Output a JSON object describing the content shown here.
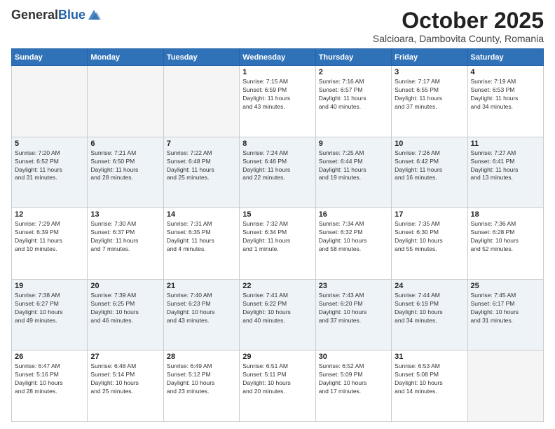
{
  "header": {
    "logo_general": "General",
    "logo_blue": "Blue",
    "month_title": "October 2025",
    "subtitle": "Salcioara, Dambovita County, Romania"
  },
  "days_of_week": [
    "Sunday",
    "Monday",
    "Tuesday",
    "Wednesday",
    "Thursday",
    "Friday",
    "Saturday"
  ],
  "weeks": [
    [
      {
        "day": "",
        "info": ""
      },
      {
        "day": "",
        "info": ""
      },
      {
        "day": "",
        "info": ""
      },
      {
        "day": "1",
        "info": "Sunrise: 7:15 AM\nSunset: 6:59 PM\nDaylight: 11 hours\nand 43 minutes."
      },
      {
        "day": "2",
        "info": "Sunrise: 7:16 AM\nSunset: 6:57 PM\nDaylight: 11 hours\nand 40 minutes."
      },
      {
        "day": "3",
        "info": "Sunrise: 7:17 AM\nSunset: 6:55 PM\nDaylight: 11 hours\nand 37 minutes."
      },
      {
        "day": "4",
        "info": "Sunrise: 7:19 AM\nSunset: 6:53 PM\nDaylight: 11 hours\nand 34 minutes."
      }
    ],
    [
      {
        "day": "5",
        "info": "Sunrise: 7:20 AM\nSunset: 6:52 PM\nDaylight: 11 hours\nand 31 minutes."
      },
      {
        "day": "6",
        "info": "Sunrise: 7:21 AM\nSunset: 6:50 PM\nDaylight: 11 hours\nand 28 minutes."
      },
      {
        "day": "7",
        "info": "Sunrise: 7:22 AM\nSunset: 6:48 PM\nDaylight: 11 hours\nand 25 minutes."
      },
      {
        "day": "8",
        "info": "Sunrise: 7:24 AM\nSunset: 6:46 PM\nDaylight: 11 hours\nand 22 minutes."
      },
      {
        "day": "9",
        "info": "Sunrise: 7:25 AM\nSunset: 6:44 PM\nDaylight: 11 hours\nand 19 minutes."
      },
      {
        "day": "10",
        "info": "Sunrise: 7:26 AM\nSunset: 6:42 PM\nDaylight: 11 hours\nand 16 minutes."
      },
      {
        "day": "11",
        "info": "Sunrise: 7:27 AM\nSunset: 6:41 PM\nDaylight: 11 hours\nand 13 minutes."
      }
    ],
    [
      {
        "day": "12",
        "info": "Sunrise: 7:29 AM\nSunset: 6:39 PM\nDaylight: 11 hours\nand 10 minutes."
      },
      {
        "day": "13",
        "info": "Sunrise: 7:30 AM\nSunset: 6:37 PM\nDaylight: 11 hours\nand 7 minutes."
      },
      {
        "day": "14",
        "info": "Sunrise: 7:31 AM\nSunset: 6:35 PM\nDaylight: 11 hours\nand 4 minutes."
      },
      {
        "day": "15",
        "info": "Sunrise: 7:32 AM\nSunset: 6:34 PM\nDaylight: 11 hours\nand 1 minute."
      },
      {
        "day": "16",
        "info": "Sunrise: 7:34 AM\nSunset: 6:32 PM\nDaylight: 10 hours\nand 58 minutes."
      },
      {
        "day": "17",
        "info": "Sunrise: 7:35 AM\nSunset: 6:30 PM\nDaylight: 10 hours\nand 55 minutes."
      },
      {
        "day": "18",
        "info": "Sunrise: 7:36 AM\nSunset: 6:28 PM\nDaylight: 10 hours\nand 52 minutes."
      }
    ],
    [
      {
        "day": "19",
        "info": "Sunrise: 7:38 AM\nSunset: 6:27 PM\nDaylight: 10 hours\nand 49 minutes."
      },
      {
        "day": "20",
        "info": "Sunrise: 7:39 AM\nSunset: 6:25 PM\nDaylight: 10 hours\nand 46 minutes."
      },
      {
        "day": "21",
        "info": "Sunrise: 7:40 AM\nSunset: 6:23 PM\nDaylight: 10 hours\nand 43 minutes."
      },
      {
        "day": "22",
        "info": "Sunrise: 7:41 AM\nSunset: 6:22 PM\nDaylight: 10 hours\nand 40 minutes."
      },
      {
        "day": "23",
        "info": "Sunrise: 7:43 AM\nSunset: 6:20 PM\nDaylight: 10 hours\nand 37 minutes."
      },
      {
        "day": "24",
        "info": "Sunrise: 7:44 AM\nSunset: 6:19 PM\nDaylight: 10 hours\nand 34 minutes."
      },
      {
        "day": "25",
        "info": "Sunrise: 7:45 AM\nSunset: 6:17 PM\nDaylight: 10 hours\nand 31 minutes."
      }
    ],
    [
      {
        "day": "26",
        "info": "Sunrise: 6:47 AM\nSunset: 5:16 PM\nDaylight: 10 hours\nand 28 minutes."
      },
      {
        "day": "27",
        "info": "Sunrise: 6:48 AM\nSunset: 5:14 PM\nDaylight: 10 hours\nand 25 minutes."
      },
      {
        "day": "28",
        "info": "Sunrise: 6:49 AM\nSunset: 5:12 PM\nDaylight: 10 hours\nand 23 minutes."
      },
      {
        "day": "29",
        "info": "Sunrise: 6:51 AM\nSunset: 5:11 PM\nDaylight: 10 hours\nand 20 minutes."
      },
      {
        "day": "30",
        "info": "Sunrise: 6:52 AM\nSunset: 5:09 PM\nDaylight: 10 hours\nand 17 minutes."
      },
      {
        "day": "31",
        "info": "Sunrise: 6:53 AM\nSunset: 5:08 PM\nDaylight: 10 hours\nand 14 minutes."
      },
      {
        "day": "",
        "info": ""
      }
    ]
  ]
}
